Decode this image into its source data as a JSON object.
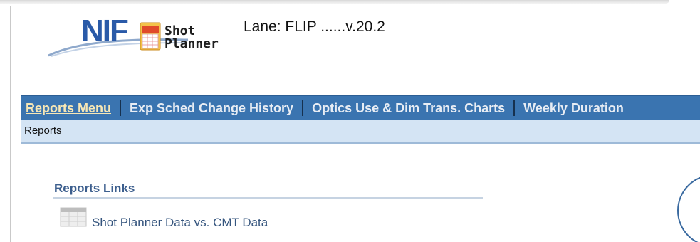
{
  "logo": {
    "nif": "NIF",
    "shot": "Shot",
    "planner": "Planner"
  },
  "header": {
    "lane": "Lane: FLIP ......v.20.2"
  },
  "nav": {
    "items": [
      {
        "label": "Reports Menu",
        "active": true
      },
      {
        "label": "Exp Sched Change History",
        "active": false
      },
      {
        "label": "Optics Use & Dim Trans. Charts",
        "active": false
      },
      {
        "label": "Weekly Duration",
        "active": false
      }
    ]
  },
  "subnav": {
    "label": "Reports"
  },
  "content": {
    "section_title": "Reports Links",
    "links": [
      {
        "label": "Shot Planner Data vs. CMT Data",
        "icon": "table-icon"
      }
    ]
  },
  "colors": {
    "nav_bg": "#3a74b0",
    "subnav_bg": "#d4e4f4",
    "logo_blue": "#2a5aa8",
    "link": "#35557e"
  }
}
